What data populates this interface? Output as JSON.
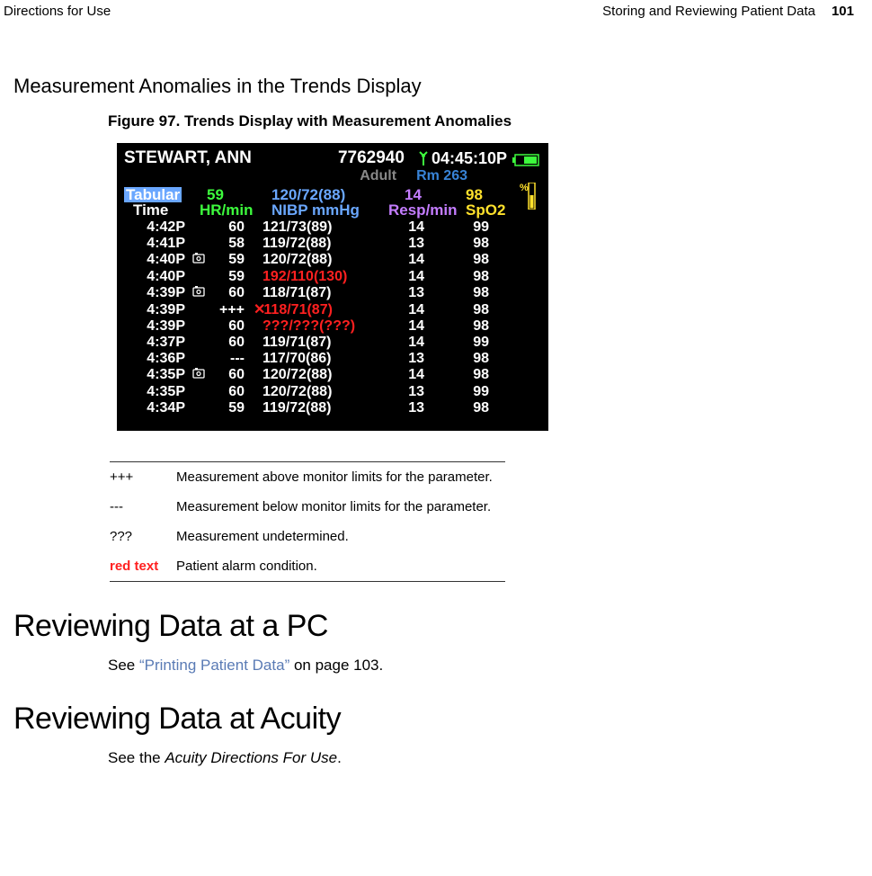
{
  "header": {
    "left": "Directions for Use",
    "right_title": "Storing and Reviewing Patient Data",
    "page": "101"
  },
  "section_title": "Measurement Anomalies in the Trends Display",
  "figure_caption": "Figure 97.  Trends Display with Measurement Anomalies",
  "monitor": {
    "patient_name": "STEWART, ANN",
    "patient_id": "7762940",
    "clock": "04:45:10P",
    "patient_type": "Adult",
    "room": "Rm 263",
    "tabular_label": "Tabular",
    "time_label": "Time",
    "hr_value": "59",
    "hr_unit": "HR/min",
    "nibp_value": "120/72(88)",
    "nibp_unit": "NIBP mmHg",
    "resp_value": "14",
    "resp_unit": "Resp/min",
    "spo2_value": "98",
    "spo2_unit": "SpO2",
    "spo2_pct": "%",
    "rows": [
      {
        "t": "4:42P",
        "ic": "",
        "hr": "60",
        "nibp": "121/73(89)",
        "nibp_red": false,
        "resp": "14",
        "spo2": "99"
      },
      {
        "t": "4:41P",
        "ic": "",
        "hr": "58",
        "nibp": "119/72(88)",
        "nibp_red": false,
        "resp": "13",
        "spo2": "98"
      },
      {
        "t": "4:40P",
        "ic": "x",
        "hr": "59",
        "nibp": "120/72(88)",
        "nibp_red": false,
        "resp": "14",
        "spo2": "98"
      },
      {
        "t": "4:40P",
        "ic": "",
        "hr": "59",
        "nibp": "192/110(130)",
        "nibp_red": true,
        "resp": "14",
        "spo2": "98"
      },
      {
        "t": "4:39P",
        "ic": "x",
        "hr": "60",
        "nibp": "118/71(87)",
        "nibp_red": false,
        "resp": "13",
        "spo2": "98"
      },
      {
        "t": "4:39P",
        "ic": "",
        "hr": "+++",
        "nibp": "118/71(87)",
        "nibp_red": true,
        "nibp_x": true,
        "resp": "14",
        "spo2": "98"
      },
      {
        "t": "4:39P",
        "ic": "",
        "hr": "60",
        "nibp": "???/???(???)",
        "nibp_red": true,
        "resp": "14",
        "spo2": "98"
      },
      {
        "t": "4:37P",
        "ic": "",
        "hr": "60",
        "nibp": "119/71(87)",
        "nibp_red": false,
        "resp": "14",
        "spo2": "99"
      },
      {
        "t": "4:36P",
        "ic": "",
        "hr": "---",
        "nibp": "117/70(86)",
        "nibp_red": false,
        "resp": "13",
        "spo2": "98"
      },
      {
        "t": "4:35P",
        "ic": "x",
        "hr": "60",
        "nibp": "120/72(88)",
        "nibp_red": false,
        "resp": "14",
        "spo2": "98"
      },
      {
        "t": "4:35P",
        "ic": "",
        "hr": "60",
        "nibp": "120/72(88)",
        "nibp_red": false,
        "resp": "13",
        "spo2": "99"
      },
      {
        "t": "4:34P",
        "ic": "",
        "hr": "59",
        "nibp": "119/72(88)",
        "nibp_red": false,
        "resp": "13",
        "spo2": "98"
      }
    ]
  },
  "legend": [
    {
      "sym": "+++",
      "desc": "Measurement above monitor limits for the parameter."
    },
    {
      "sym": "---",
      "desc": "Measurement below monitor limits for the parameter."
    },
    {
      "sym": "???",
      "desc": "Measurement undetermined."
    },
    {
      "sym": "red text",
      "desc": "Patient alarm condition.",
      "red": true
    }
  ],
  "h1a": "Reviewing Data at a PC",
  "body_a_pre": "See ",
  "body_a_link": "“Printing Patient Data”",
  "body_a_post": " on page 103.",
  "h1b": "Reviewing Data at Acuity",
  "body_b_pre": "See the ",
  "body_b_italic": "Acuity Directions For Use",
  "body_b_post": "."
}
